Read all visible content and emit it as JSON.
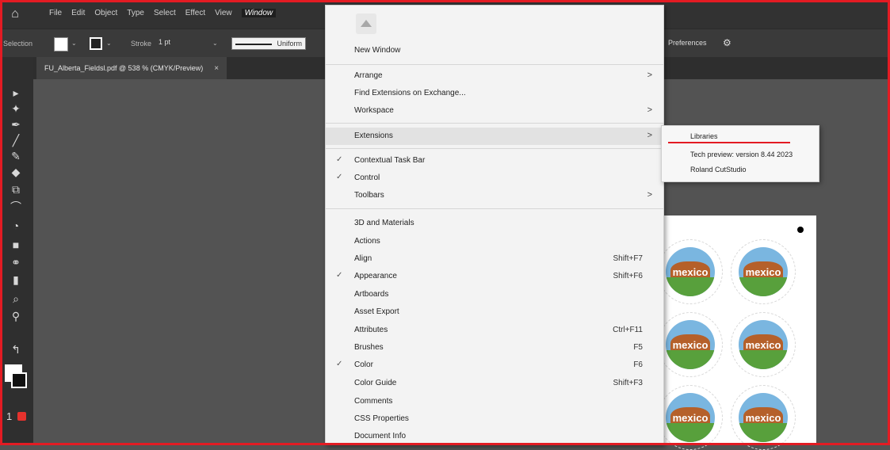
{
  "menubar": {
    "items": [
      "File",
      "Edit",
      "Object",
      "Type",
      "Select",
      "Effect",
      "View",
      "Window"
    ],
    "active": "Window"
  },
  "controlbar": {
    "label": "Selection",
    "stroke_label": "Stroke",
    "stroke_value": "1 pt",
    "profile": "Uniform",
    "preferences": "Preferences"
  },
  "document_tab": {
    "title": "FU_Alberta_Fieldsl.pdf @ 538 % (CMYK/Preview)",
    "close": "×"
  },
  "window_menu": {
    "items": [
      {
        "label": "New Window"
      },
      {
        "label": "Arrange",
        "submenu": true
      },
      {
        "label": "Find Extensions on Exchange..."
      },
      {
        "label": "Workspace",
        "submenu": true
      },
      {
        "label": "Extensions",
        "submenu": true,
        "highlighted": true
      },
      {
        "label": "Contextual Task Bar",
        "checked": true
      },
      {
        "label": "Control",
        "checked": true
      },
      {
        "label": "Toolbars",
        "submenu": true
      },
      {
        "label": "3D and Materials"
      },
      {
        "label": "Actions"
      },
      {
        "label": "Align",
        "shortcut": "Shift+F7"
      },
      {
        "label": "Appearance",
        "checked": true,
        "shortcut": "Shift+F6"
      },
      {
        "label": "Artboards"
      },
      {
        "label": "Asset Export"
      },
      {
        "label": "Attributes",
        "shortcut": "Ctrl+F11"
      },
      {
        "label": "Brushes",
        "shortcut": "F5"
      },
      {
        "label": "Color",
        "checked": true,
        "shortcut": "F6"
      },
      {
        "label": "Color Guide",
        "shortcut": "Shift+F3"
      },
      {
        "label": "Comments"
      },
      {
        "label": "CSS Properties"
      },
      {
        "label": "Document Info"
      }
    ],
    "check_mark": "✓",
    "submenu_arrow": ">"
  },
  "extensions_submenu": {
    "items": [
      "Libraries",
      "Tech preview: version 8.44 2023",
      "Roland CutStudio"
    ]
  },
  "artboard": {
    "sticker_text": "mexico"
  },
  "colors": {
    "highlight_border": "#e31b23",
    "menu_bg": "#f3f3f3",
    "app_bg": "#535353"
  },
  "icons": {
    "home": "home-icon",
    "tools": [
      "selection-tool-icon",
      "direct-selection-tool-icon",
      "pen-tool-icon",
      "line-tool-icon",
      "pencil-tool-icon",
      "shaper-tool-icon",
      "scale-tool-icon",
      "warp-tool-icon",
      "shape-builder-tool-icon",
      "gradient-tool-icon",
      "blend-tool-icon",
      "graph-tool-icon",
      "eyedropper-tool-icon",
      "zoom-tool-icon",
      "swap-icon"
    ]
  }
}
